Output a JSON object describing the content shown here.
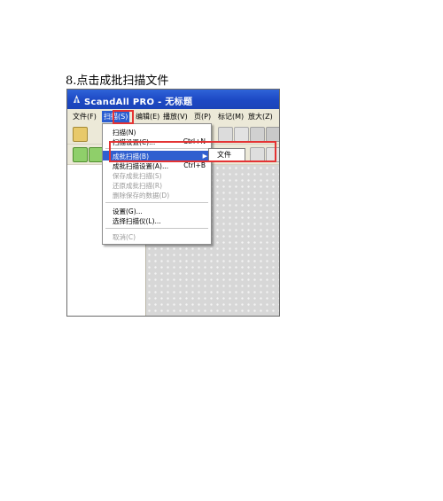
{
  "step_title": "8.点击成批扫描文件",
  "window": {
    "title": "ScandAll PRO - 无标题",
    "titlebar_color": "#1f4fcb"
  },
  "menubar": {
    "items": [
      "文件(F)",
      "扫描(S)",
      "编辑(E)",
      "播放(V)",
      "页(P)",
      "标记(M)",
      "放大(Z)"
    ],
    "active_index": 1
  },
  "scan_menu": {
    "items": [
      {
        "label": "扫描(N)",
        "shortcut": "",
        "enabled": true
      },
      {
        "label": "扫描设置(C)...",
        "shortcut": "Ctrl+N",
        "enabled": true
      },
      {
        "label": "成批扫描(B)",
        "shortcut": "",
        "enabled": true,
        "selected": true,
        "has_submenu": true
      },
      {
        "label": "成批扫描设置(A)...",
        "shortcut": "Ctrl+B",
        "enabled": true
      },
      {
        "label": "保存成批扫描(S)",
        "shortcut": "",
        "enabled": false
      },
      {
        "label": "还原成批扫描(R)",
        "shortcut": "",
        "enabled": false
      },
      {
        "label": "删除保存的数据(D)",
        "shortcut": "",
        "enabled": false
      },
      {
        "label": "设置(G)...",
        "shortcut": "",
        "enabled": true
      },
      {
        "label": "选择扫描仪(L)...",
        "shortcut": "",
        "enabled": true
      },
      {
        "label": "取消(C)",
        "shortcut": "",
        "enabled": false
      }
    ]
  },
  "submenu": {
    "items": [
      "文件"
    ]
  },
  "colors": {
    "highlight_box": "#e43333",
    "menu_selection": "#2f5fcf",
    "toolbar": "#ece9d8"
  }
}
